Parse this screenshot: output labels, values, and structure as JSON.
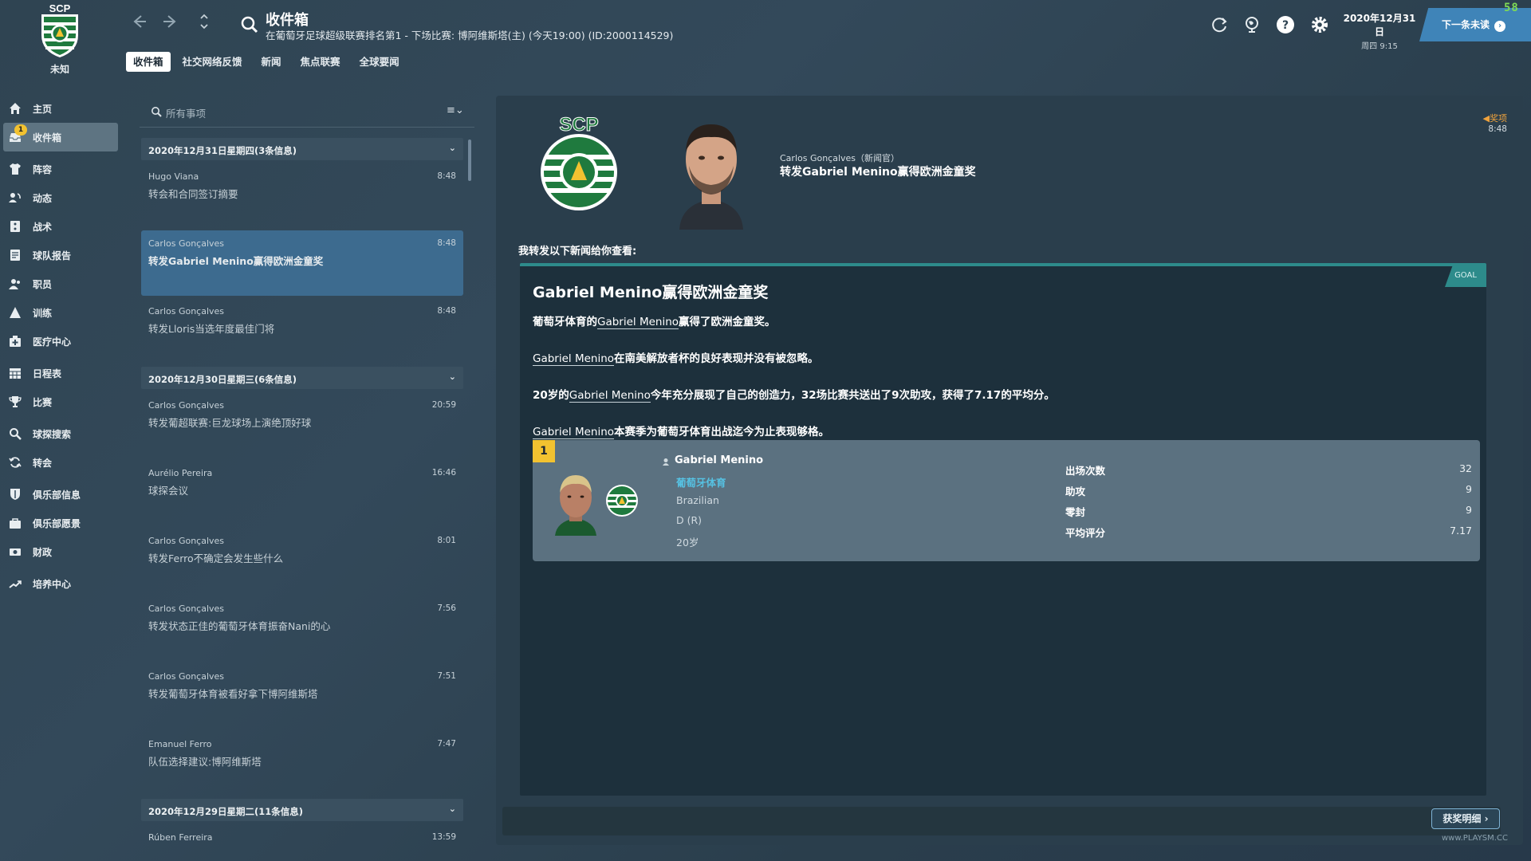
{
  "header": {
    "club_name": "未知",
    "club_logo_text": "SCP",
    "title": "收件箱",
    "subtitle": "在葡萄牙足球超级联赛排名第1 - 下场比赛: 博阿维斯塔(主) (今天19:00) (ID:2000114529)",
    "tabs": [
      "收件箱",
      "社交网络反馈",
      "新闻",
      "焦点联赛",
      "全球要闻"
    ],
    "date": "2020年12月31日",
    "date_sub": "周四 9:15",
    "continue_label": "下一条未读",
    "corner_badge": "58"
  },
  "sidebar": {
    "items": [
      {
        "label": "主页",
        "icon": "home-icon"
      },
      {
        "label": "收件箱",
        "icon": "inbox-icon",
        "badge": "1"
      },
      {
        "label": "阵容",
        "icon": "shirt-icon"
      },
      {
        "label": "动态",
        "icon": "dynamics-icon"
      },
      {
        "label": "战术",
        "icon": "tactics-icon"
      },
      {
        "label": "球队报告",
        "icon": "report-icon"
      },
      {
        "label": "职员",
        "icon": "staff-icon"
      },
      {
        "label": "训练",
        "icon": "training-icon"
      },
      {
        "label": "医疗中心",
        "icon": "medical-icon"
      },
      {
        "label": "日程表",
        "icon": "calendar-icon"
      },
      {
        "label": "比赛",
        "icon": "trophy-icon"
      },
      {
        "label": "球探搜索",
        "icon": "scout-icon"
      },
      {
        "label": "转会",
        "icon": "transfer-icon"
      },
      {
        "label": "俱乐部信息",
        "icon": "shield-icon"
      },
      {
        "label": "俱乐部愿景",
        "icon": "vision-icon"
      },
      {
        "label": "财政",
        "icon": "finance-icon"
      },
      {
        "label": "培养中心",
        "icon": "development-icon"
      }
    ]
  },
  "inbox": {
    "search_placeholder": "所有事项",
    "groups": [
      {
        "label": "2020年12月31日星期四(3条信息)"
      },
      {
        "label": "2020年12月30日星期三(6条信息)"
      },
      {
        "label": "2020年12月29日星期二(11条信息)"
      }
    ],
    "messages": [
      {
        "sender": "Hugo Viana",
        "subject": "转会和合同签订摘要",
        "time": "8:48"
      },
      {
        "sender": "Carlos Gonçalves",
        "subject": "转发Gabriel Menino赢得欧洲金童奖",
        "time": "8:48"
      },
      {
        "sender": "Carlos Gonçalves",
        "subject": "转发Lloris当选年度最佳门将",
        "time": "8:48"
      },
      {
        "sender": "Carlos Gonçalves",
        "subject": "转发葡超联赛:巨龙球场上演绝顶好球",
        "time": "20:59"
      },
      {
        "sender": "Aurélio Pereira",
        "subject": "球探会议",
        "time": "16:46"
      },
      {
        "sender": "Carlos Gonçalves",
        "subject": "转发Ferro不确定会发生些什么",
        "time": "8:01"
      },
      {
        "sender": "Carlos Gonçalves",
        "subject": "转发状态正佳的葡萄牙体育振奋Nani的心",
        "time": "7:56"
      },
      {
        "sender": "Carlos Gonçalves",
        "subject": "转发葡萄牙体育被看好拿下博阿维斯塔",
        "time": "7:51"
      },
      {
        "sender": "Emanuel Ferro",
        "subject": "队伍选择建议:博阿维斯塔",
        "time": "7:47"
      },
      {
        "sender": "Rúben Ferreira",
        "subject": "",
        "time": "13:59"
      }
    ]
  },
  "detail": {
    "from": "Carlos Gonçalves（新闻官）",
    "subject": "转发Gabriel Menino赢得欧洲金童奖",
    "tag": "奖项",
    "time": "8:48",
    "intro": "我转发以下新闻给你查看:",
    "news": {
      "badge": "GOAL",
      "title": "Gabriel Menino赢得欧洲金童奖",
      "p1_pre": "葡萄牙体育的",
      "p1_link": "Gabriel Menino",
      "p1_post": "赢得了欧洲金童奖。",
      "p2_link": "Gabriel Menino",
      "p2_post": "在南美解放者杯的良好表现并没有被忽略。",
      "p3_pre": "20岁的",
      "p3_link": "Gabriel Menino",
      "p3_post": "今年充分展现了自己的创造力，32场比赛共送出了9次助攻，获得了7.17的平均分。",
      "p4_link": "Gabriel Menino",
      "p4_post": "本赛季为葡萄牙体育出战迄今为止表现够格。"
    },
    "player": {
      "rank": "1",
      "name": "Gabriel Menino",
      "club": "葡萄牙体育",
      "nationality": "Brazilian",
      "position": "D (R)",
      "age": "20岁",
      "stats": [
        {
          "label": "出场次数",
          "value": "32"
        },
        {
          "label": "助攻",
          "value": "9"
        },
        {
          "label": "零封",
          "value": "9"
        },
        {
          "label": "平均评分",
          "value": "7.17"
        }
      ]
    },
    "award_button": "获奖明细",
    "watermark": "www.PLAYSM.CC"
  },
  "colors": {
    "accent_blue": "#3f84b8",
    "selected_row": "#3d6b8f",
    "rank_yellow": "#f2c230",
    "goal_teal": "#2d8b8b",
    "club_link": "#56c2e3",
    "tag_orange": "#f0a33d"
  }
}
